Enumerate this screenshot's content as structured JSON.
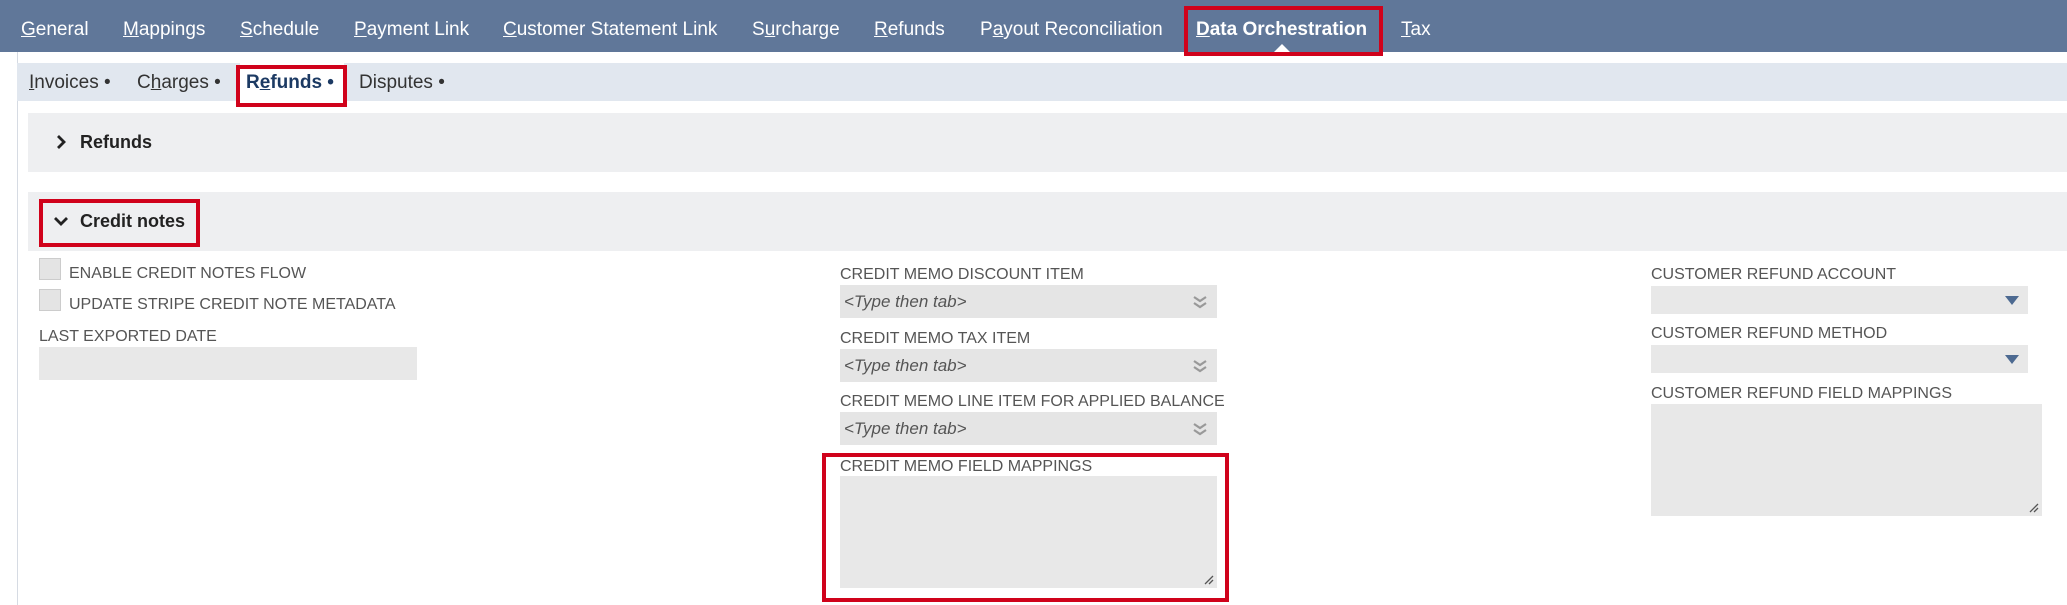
{
  "top_nav": {
    "tabs": [
      {
        "first": "G",
        "rest": "eneral"
      },
      {
        "first": "M",
        "rest": "appings"
      },
      {
        "first": "S",
        "rest": "chedule"
      },
      {
        "first": "P",
        "rest": "ayment Link"
      },
      {
        "first": "C",
        "rest": "ustomer Statement Link"
      },
      {
        "pre": "S",
        "first": "u",
        "rest": "rcharge"
      },
      {
        "first": "R",
        "rest": "efunds"
      },
      {
        "pre": "P",
        "first": "a",
        "rest": "yout Reconciliation"
      },
      {
        "first": "D",
        "rest": "ata Orchestration"
      },
      {
        "first": "T",
        "rest": "ax"
      }
    ]
  },
  "sub_nav": {
    "tabs": [
      {
        "first": "I",
        "rest": "nvoices •"
      },
      {
        "pre": "C",
        "first": "h",
        "rest": "arges •"
      },
      {
        "pre": "R",
        "first": "e",
        "rest": "funds •"
      },
      {
        "first": "",
        "rest": "Disputes •"
      }
    ]
  },
  "sections": {
    "refunds": {
      "title": "Refunds"
    },
    "credit_notes": {
      "title": "Credit notes"
    }
  },
  "form": {
    "enable_credit_notes_flow": "ENABLE CREDIT NOTES FLOW",
    "update_stripe_metadata": "UPDATE STRIPE CREDIT NOTE METADATA",
    "last_exported_date": "LAST EXPORTED DATE",
    "discount_item_label": "CREDIT MEMO DISCOUNT ITEM",
    "discount_item_value": "<Type then tab>",
    "tax_item_label": "CREDIT MEMO TAX ITEM",
    "tax_item_value": "<Type then tab>",
    "line_item_label": "CREDIT MEMO LINE ITEM FOR APPLIED BALANCE",
    "line_item_value": "<Type then tab>",
    "field_mappings_label": "CREDIT MEMO FIELD MAPPINGS",
    "refund_account_label": "CUSTOMER REFUND ACCOUNT",
    "refund_method_label": "CUSTOMER REFUND METHOD",
    "refund_field_mappings_label": "CUSTOMER REFUND FIELD MAPPINGS"
  },
  "colors": {
    "nav_bg": "#607799",
    "subnav_bg": "#e1e7ef",
    "highlight": "#d0021b"
  }
}
